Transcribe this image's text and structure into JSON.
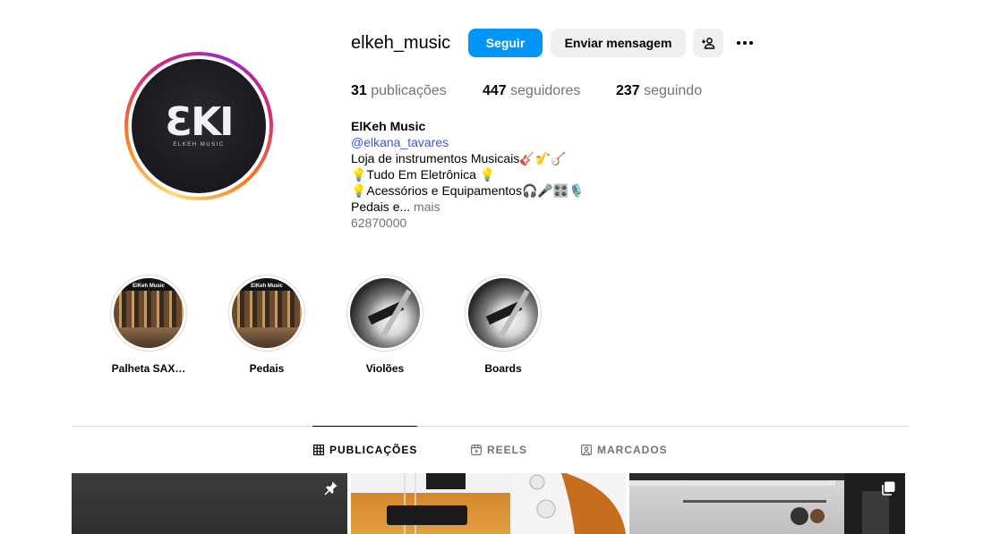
{
  "profile": {
    "username": "elkeh_music",
    "follow_label": "Seguir",
    "message_label": "Enviar mensagem",
    "avatar_logo": "ƐKI",
    "avatar_logo_sub": "ELKEH MUSIC"
  },
  "stats": {
    "posts_count": "31",
    "posts_label": "publicações",
    "followers_count": "447",
    "followers_label": "seguidores",
    "following_count": "237",
    "following_label": "seguindo"
  },
  "bio": {
    "name": "ElKeh Music",
    "link": "@elkana_tavares",
    "line1": "Loja de instrumentos Musicais🎸🎷🪕",
    "line2": "💡Tudo Em Eletrônica 💡",
    "line3": "💡Acessórios e Equipamentos🎧🎤🎛️🎙️",
    "line4": "Pedais e...",
    "more_label": "mais",
    "phone": "62870000"
  },
  "highlights": [
    {
      "label": "Palheta SAX…",
      "image": "store",
      "store_text": "ElKeh Music"
    },
    {
      "label": "Pedais",
      "image": "store",
      "store_text": "ElKeh Music"
    },
    {
      "label": "Violões",
      "image": "guitar"
    },
    {
      "label": "Boards",
      "image": "guitar"
    }
  ],
  "tabs": [
    {
      "label": "PUBLICAÇÕES",
      "icon": "grid-icon",
      "active": true
    },
    {
      "label": "REELS",
      "icon": "reels-icon",
      "active": false
    },
    {
      "label": "MARCADOS",
      "icon": "tagged-icon",
      "active": false
    }
  ],
  "posts": [
    {
      "badge": "pin-icon"
    },
    {
      "badge": ""
    },
    {
      "badge": "carousel-icon"
    }
  ],
  "colors": {
    "accent": "#0095f6",
    "link": "#4150f7",
    "muted": "#737373"
  }
}
